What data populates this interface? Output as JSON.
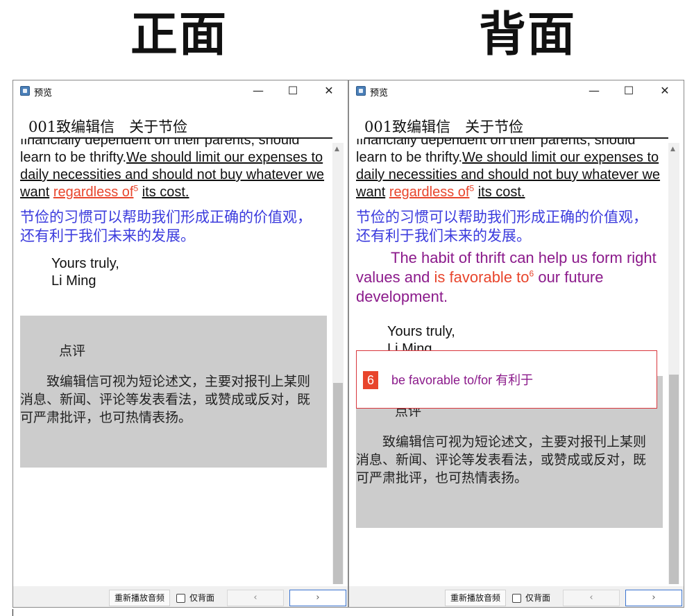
{
  "headings": {
    "front": "正面",
    "back": "背面"
  },
  "window": {
    "title": "预览",
    "min_glyph": "—",
    "max_glyph": "☐",
    "close_glyph": "✕",
    "scroll_up_glyph": "▲"
  },
  "doc": {
    "title": "001致编辑信　关于节俭",
    "line_partial": "financially dependent on their parents,",
    "text_plain": "should learn to be thrifty.",
    "text_underline_1": "We should limit our expenses to daily necessities and should not buy whatever we want",
    "phrase_red": "regardless of",
    "sup_5": "5",
    "text_underline_2": "its cost.",
    "cn_sentence": "节俭的习惯可以帮助我们形成正确的价值观，还有利于我们未来的发展。",
    "translation": {
      "before": "The habit of thrift can help us form right values and",
      "red": "is favorable to",
      "sup": "6",
      "after": "our future development."
    },
    "closing_1": "Yours truly,",
    "closing_2": "Li Ming"
  },
  "comment": {
    "heading": "点评",
    "body": "致编辑信可视为短论述文，主要对报刊上某则消息、新闻、评论等发表看法，或赞成或反对，既可严肃批评，也可热情表扬。"
  },
  "popup": {
    "number": "6",
    "text": "be favorable to/for 有利于"
  },
  "bottombar": {
    "replay_label": "重新播放音频",
    "checkbox_label": "仅背面",
    "prev_glyph": "‹",
    "next_glyph": "›"
  },
  "colors": {
    "phrase_red": "#e8452c",
    "chinese_blue": "#3b3bdd",
    "translation_purple": "#8b1a8b",
    "comment_bg": "#cccccc",
    "popup_border": "#d8353b"
  }
}
